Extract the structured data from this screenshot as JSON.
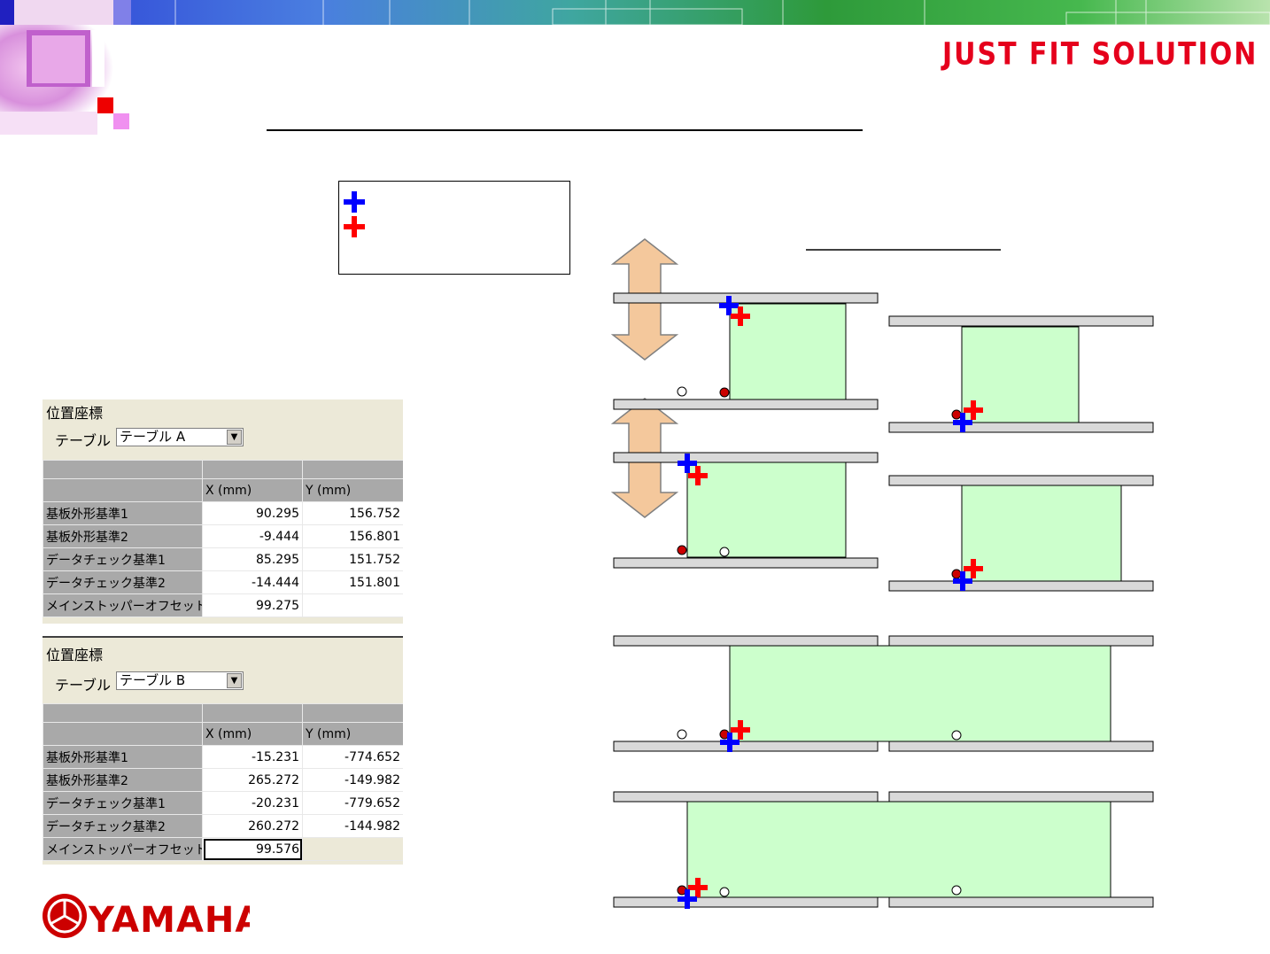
{
  "header": {
    "brand_slogan": "JUST FIT SOLUTION"
  },
  "legend": {
    "items": [
      {
        "icon": "blue-cross-icon",
        "label": ""
      },
      {
        "icon": "red-cross-icon",
        "label": ""
      }
    ]
  },
  "colors": {
    "blue_cross": "#0000ff",
    "red_cross": "#ff0000",
    "board": "#ccffcc",
    "rail": "#d9d9d9",
    "reference_dot": "#cc0000"
  },
  "panel_a": {
    "title": "位置座標",
    "table_label": "テーブル",
    "selected_table": "テーブル A",
    "columns": [
      "",
      "X (mm)",
      "Y (mm)"
    ],
    "rows": [
      {
        "name": "基板外形基準1",
        "x": "90.295",
        "y": "156.752"
      },
      {
        "name": "基板外形基準2",
        "x": "-9.444",
        "y": "156.801"
      },
      {
        "name": "データチェック基準1",
        "x": "85.295",
        "y": "151.752"
      },
      {
        "name": "データチェック基準2",
        "x": "-14.444",
        "y": "151.801"
      },
      {
        "name": "メインストッパーオフセット",
        "x": "99.275",
        "y": ""
      }
    ]
  },
  "panel_b": {
    "title": "位置座標",
    "table_label": "テーブル",
    "selected_table": "テーブル B",
    "columns": [
      "",
      "X (mm)",
      "Y (mm)"
    ],
    "rows": [
      {
        "name": "基板外形基準1",
        "x": "-15.231",
        "y": "-774.652"
      },
      {
        "name": "基板外形基準2",
        "x": "265.272",
        "y": "-149.982"
      },
      {
        "name": "データチェック基準1",
        "x": "-20.231",
        "y": "-779.652"
      },
      {
        "name": "データチェック基準2",
        "x": "260.272",
        "y": "-144.982"
      },
      {
        "name": "メインストッパーオフセット",
        "x": "99.576",
        "y": ""
      }
    ]
  },
  "footer": {
    "logo_text": "YAMAHA"
  }
}
